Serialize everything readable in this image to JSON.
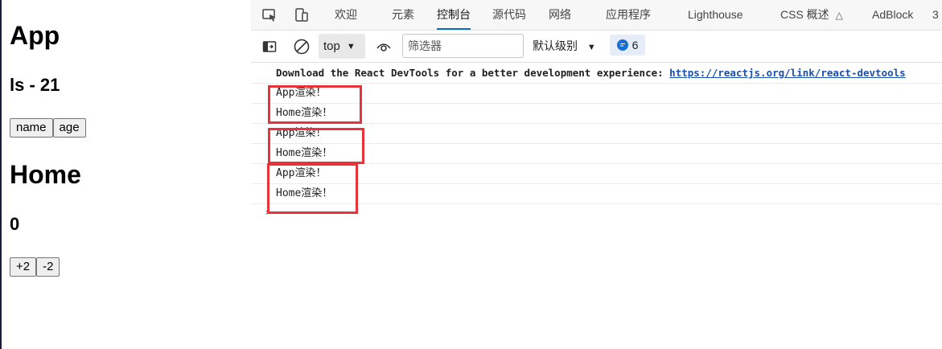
{
  "app": {
    "title": "App",
    "user_line": "ls - 21",
    "buttons": [
      "name",
      "age"
    ],
    "home_title": "Home",
    "count": "0",
    "home_buttons": [
      "+2",
      "-2"
    ]
  },
  "devtools": {
    "tabs": [
      "欢迎",
      "元素",
      "控制台",
      "源代码",
      "网络",
      "应用程序",
      "Lighthouse",
      "CSS 概述",
      "AdBlock",
      "3"
    ],
    "active_tab": "控制台",
    "context": "top",
    "filter_placeholder": "筛选器",
    "level": "默认级别",
    "issue_count": "6",
    "console": {
      "devtools_hint": "Download the React DevTools for a better development experience: ",
      "devtools_link": "https://reactjs.org/link/react-devtools",
      "messages": [
        "App渲染！",
        "Home渲染！",
        "App渲染！",
        "Home渲染！",
        "App渲染！",
        "Home渲染！"
      ]
    },
    "highlight_color": "#e8333a",
    "accent": "#0f6cbd"
  }
}
